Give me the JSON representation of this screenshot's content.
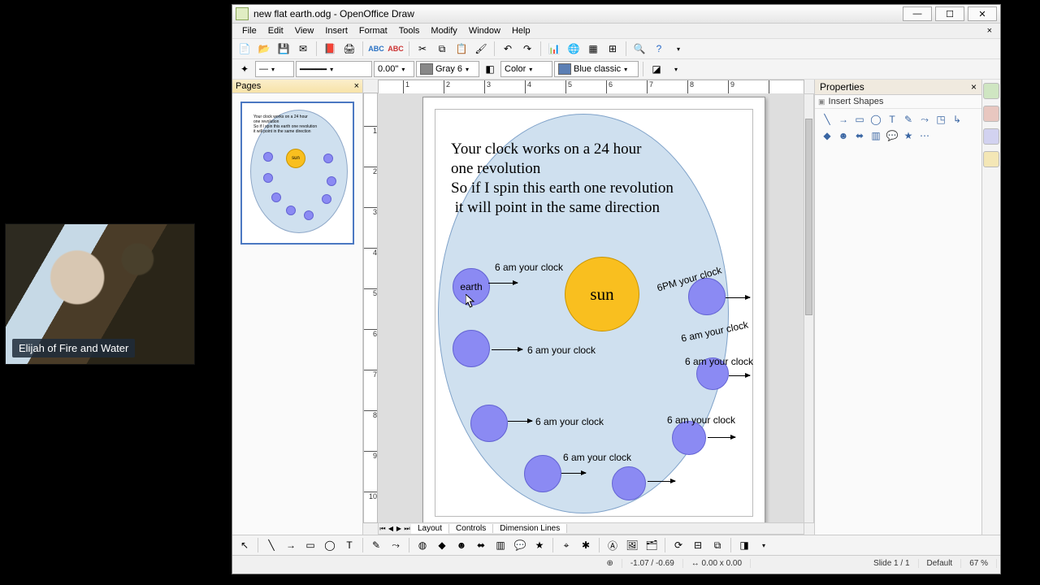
{
  "window": {
    "title": "new flat earth.odg - OpenOffice Draw",
    "min_icon": "—",
    "max_icon": "☐",
    "close_icon": "✕"
  },
  "menu": {
    "file": "File",
    "edit": "Edit",
    "view": "View",
    "insert": "Insert",
    "format": "Format",
    "tools": "Tools",
    "modify": "Modify",
    "window": "Window",
    "help": "Help",
    "close": "×"
  },
  "toolbar2": {
    "line_width": "0.00\"",
    "line_color_name": "Gray 6",
    "fill_mode": "Color",
    "fill_name": "Blue classic"
  },
  "pages_panel": {
    "title": "Pages",
    "close": "×",
    "thumb_sun": "sun"
  },
  "ruler": {
    "h": [
      "1",
      "2",
      "3",
      "4",
      "5",
      "6",
      "7",
      "8",
      "9"
    ],
    "v": [
      "1",
      "2",
      "3",
      "4",
      "5",
      "6",
      "7",
      "8",
      "9",
      "10"
    ]
  },
  "doc": {
    "text_line1": "Your clock works on a 24 hour",
    "text_line2": "one revolution",
    "text_line3": "So if I spin this earth one revolution",
    "text_line4": " it will point in the same direction",
    "sun": "sun",
    "earth": "earth",
    "labels": {
      "l0": "6 am your clock",
      "l1": "6PM your clock",
      "l2": "6 am your clock",
      "l3": "6 am your clock",
      "l4": "6 am your clock",
      "l5": "6 am your clock",
      "l6": "6 am your clock",
      "l7": "6 am your clock"
    }
  },
  "tabs": {
    "layout": "Layout",
    "controls": "Controls",
    "dim": "Dimension Lines"
  },
  "props": {
    "title": "Properties",
    "close": "×",
    "group": "Insert Shapes"
  },
  "status": {
    "coords": "-1.07 / -0.69",
    "size": "0.00 x 0.00",
    "slide": "Slide 1 / 1",
    "style": "Default",
    "zoom": "67 %"
  },
  "overlay": {
    "name": "Elijah of Fire and Water"
  }
}
